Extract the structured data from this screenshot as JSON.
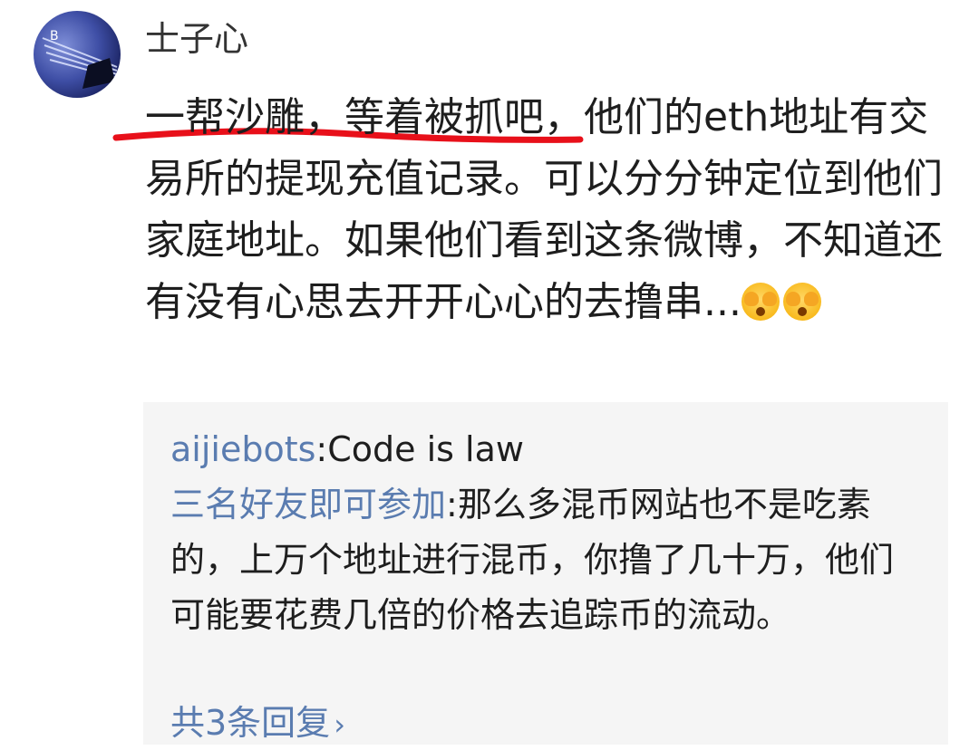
{
  "comment": {
    "author": "士子心",
    "text": "一帮沙雕，等着被抓吧，他们的eth地址有交易所的提现充值记录。可以分分钟定位到他们家庭地址。如果他们看到这条微博，不知道还有没有心思去开开心心的去撸串...",
    "emojis": [
      "covering-eyes-emoji",
      "covering-eyes-emoji"
    ],
    "annotation_color": "#e8101a"
  },
  "replies": [
    {
      "user": "aijiebots",
      "text": ":Code is law"
    },
    {
      "user": "三名好友即可参加",
      "text": ":那么多混币网站也不是吃素的，上万个地址进行混币，你撸了几十万，他们可能要花费几倍的价格去追踪币的流动。"
    }
  ],
  "more_replies": {
    "label": "共3条回复",
    "chevron": "›"
  },
  "colors": {
    "link": "#5a7cb0",
    "reply_bg": "#f5f5f5",
    "text": "#1e1e1e"
  }
}
